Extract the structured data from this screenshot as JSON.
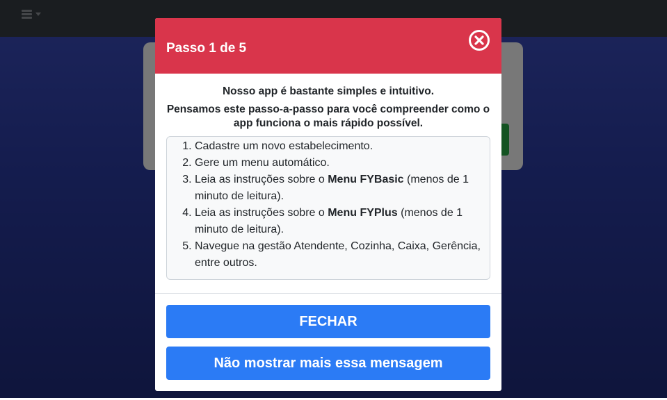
{
  "modal": {
    "title": "Passo 1 de 5",
    "intro1": "Nosso app é bastante simples e intuitivo.",
    "intro2": "Pensamos este passo-a-passo para você compreender como o app funciona o mais rápido possível.",
    "steps": [
      {
        "pre": "Cadastre um novo estabelecimento.",
        "bold": "",
        "post": ""
      },
      {
        "pre": "Gere um menu automático.",
        "bold": "",
        "post": ""
      },
      {
        "pre": "Leia as instruções sobre o ",
        "bold": "Menu FYBasic",
        "post": " (menos de 1 minuto de leitura)."
      },
      {
        "pre": "Leia as instruções sobre o ",
        "bold": "Menu FYPlus",
        "post": " (menos de 1 minuto de leitura)."
      },
      {
        "pre": "Navegue na gestão Atendente, Cozinha, Caixa, Gerência, entre outros.",
        "bold": "",
        "post": ""
      }
    ],
    "close_label": "FECHAR",
    "dont_show_label": "Não mostrar mais essa mensagem"
  },
  "icons": {
    "menu": "hamburger-icon",
    "close": "close-circle-icon"
  },
  "colors": {
    "header": "#d9354b",
    "button": "#2b7bf5",
    "topbar": "#343a40"
  }
}
